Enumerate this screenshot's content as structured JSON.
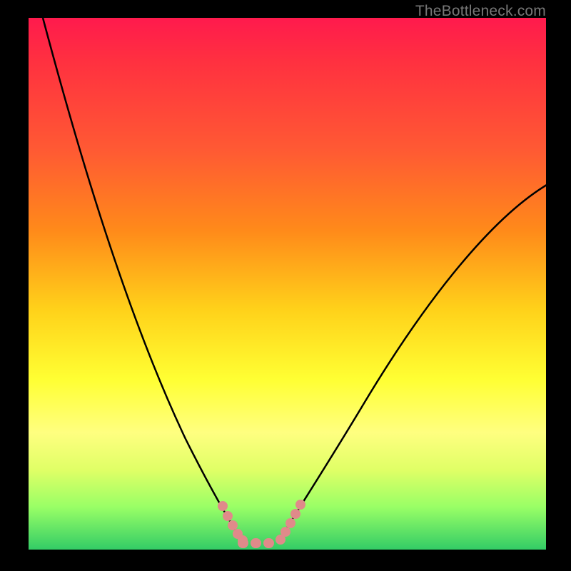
{
  "watermark": "TheBottleneck.com",
  "chart_data": {
    "type": "line",
    "title": "",
    "xlabel": "",
    "ylabel": "",
    "ylim": [
      0,
      100
    ],
    "xlim": [
      0,
      100
    ],
    "background_gradient": [
      "#ff1a4d",
      "#ff3040",
      "#ff8a1a",
      "#ffff33",
      "#99ff66",
      "#33cc66"
    ],
    "series": [
      {
        "name": "curve-left",
        "color": "#000000",
        "x": [
          3,
          10,
          20,
          30,
          35,
          39,
          42
        ],
        "y": [
          100,
          72,
          38,
          14,
          6,
          2,
          0
        ]
      },
      {
        "name": "valley-highlight",
        "color": "#e08a8a",
        "x": [
          37,
          38.5,
          40,
          42,
          44,
          46,
          48,
          49.5,
          50.5,
          51.5
        ],
        "y": [
          6,
          3,
          1.2,
          0.3,
          0.3,
          0.3,
          0.3,
          1.2,
          3,
          6
        ]
      },
      {
        "name": "curve-right",
        "color": "#000000",
        "x": [
          48,
          52,
          58,
          66,
          76,
          88,
          100
        ],
        "y": [
          0,
          5,
          14,
          26,
          40,
          55,
          68
        ]
      }
    ]
  }
}
